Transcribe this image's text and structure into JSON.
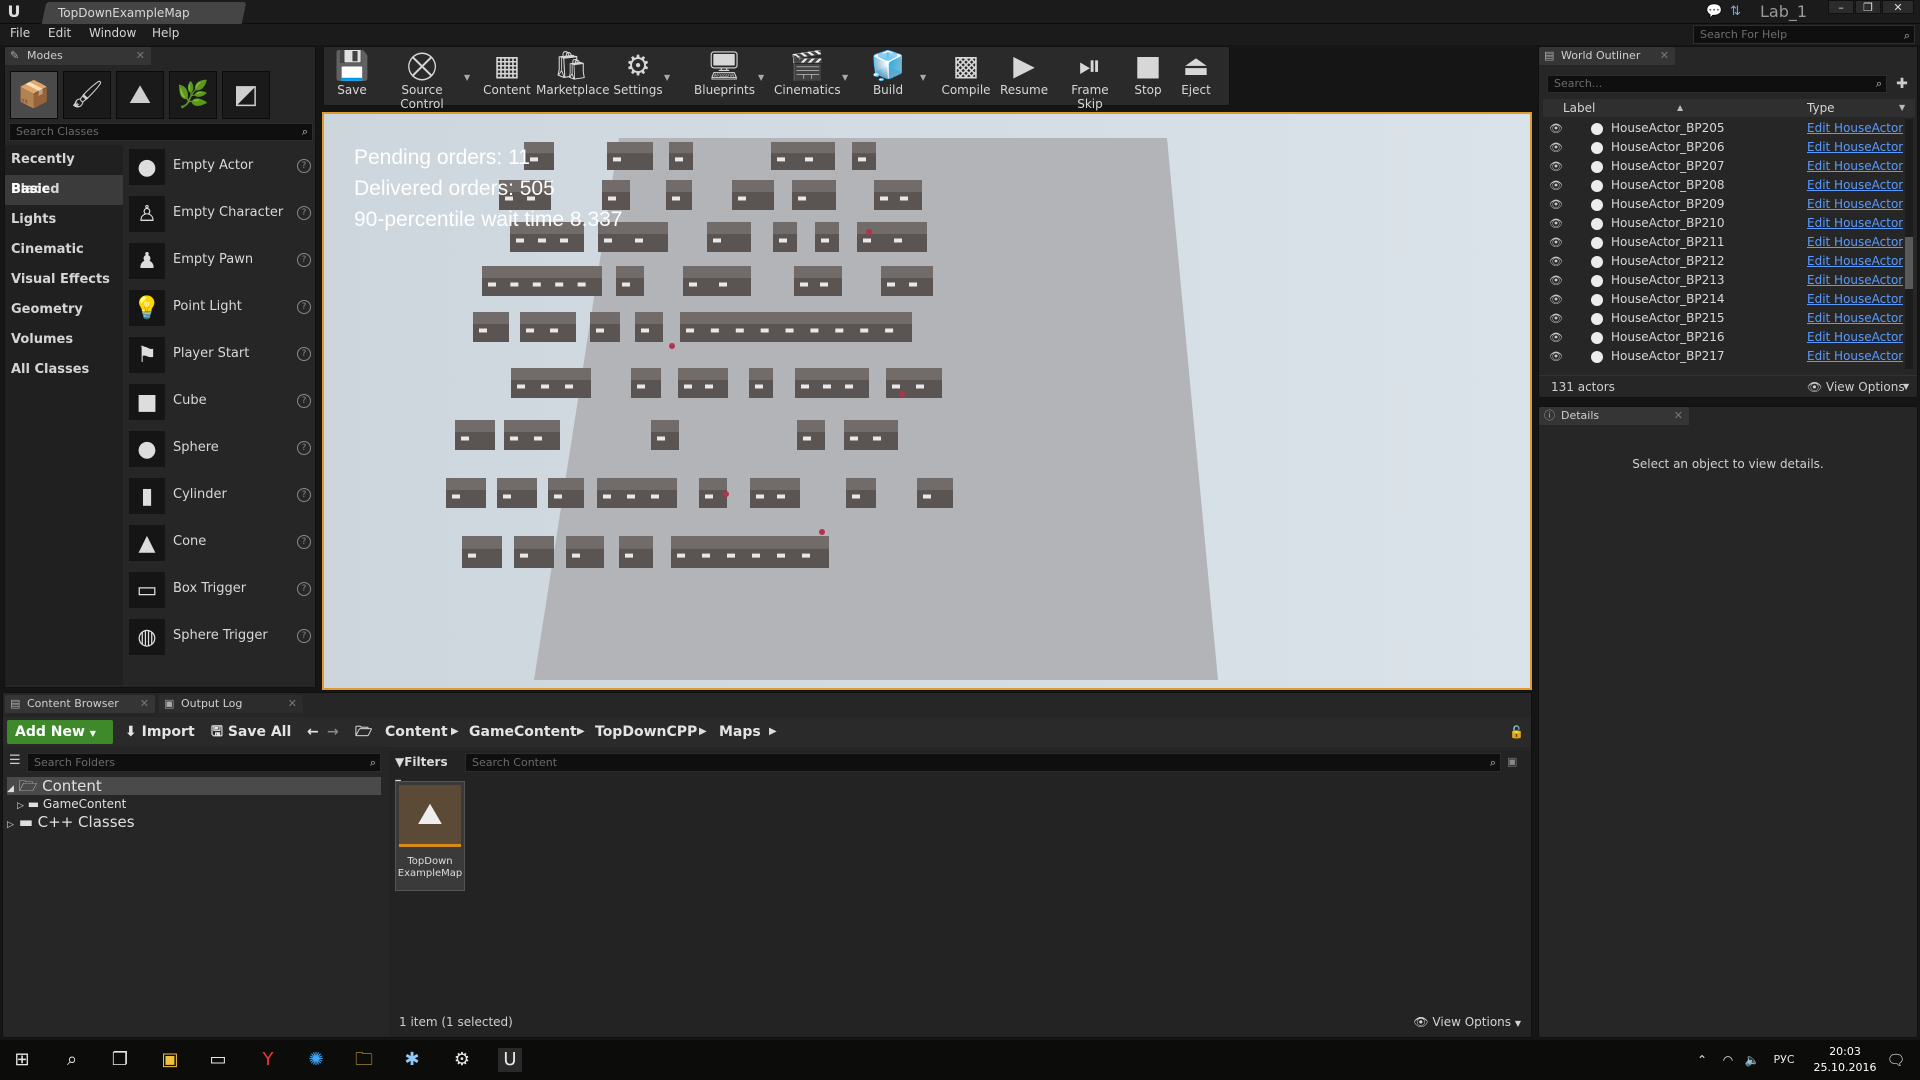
{
  "window": {
    "doc_tab": "TopDownExampleMap",
    "project": "Lab_1",
    "controls": [
      "–",
      "❐",
      "✕"
    ]
  },
  "menu": [
    "File",
    "Edit",
    "Window",
    "Help"
  ],
  "help_search": {
    "placeholder": "Search For Help"
  },
  "modes": {
    "tab": "Modes",
    "search_placeholder": "Search Classes",
    "categories": [
      "Recently Placed",
      "Basic",
      "Lights",
      "Cinematic",
      "Visual Effects",
      "Geometry",
      "Volumes",
      "All Classes"
    ],
    "selected_category": "Basic",
    "items": [
      "Empty Actor",
      "Empty Character",
      "Empty Pawn",
      "Point Light",
      "Player Start",
      "Cube",
      "Sphere",
      "Cylinder",
      "Cone",
      "Box Trigger",
      "Sphere Trigger"
    ]
  },
  "toolbar": {
    "buttons": [
      "Save",
      "Source Control",
      "Content",
      "Marketplace",
      "Settings",
      "Blueprints",
      "Cinematics",
      "Build",
      "Compile",
      "Resume",
      "Frame Skip",
      "Stop",
      "Eject"
    ]
  },
  "viewport": {
    "hud": [
      "Pending orders: 11",
      "Delivered orders: 505",
      "90-percentile wait time 8.337"
    ]
  },
  "outliner": {
    "tab": "World Outliner",
    "search_placeholder": "Search...",
    "col_label": "Label",
    "col_type": "Type",
    "rows": [
      {
        "label": "HouseActor_BP205",
        "type": "Edit HouseActor"
      },
      {
        "label": "HouseActor_BP206",
        "type": "Edit HouseActor"
      },
      {
        "label": "HouseActor_BP207",
        "type": "Edit HouseActor"
      },
      {
        "label": "HouseActor_BP208",
        "type": "Edit HouseActor"
      },
      {
        "label": "HouseActor_BP209",
        "type": "Edit HouseActor"
      },
      {
        "label": "HouseActor_BP210",
        "type": "Edit HouseActor"
      },
      {
        "label": "HouseActor_BP211",
        "type": "Edit HouseActor"
      },
      {
        "label": "HouseActor_BP212",
        "type": "Edit HouseActor"
      },
      {
        "label": "HouseActor_BP213",
        "type": "Edit HouseActor"
      },
      {
        "label": "HouseActor_BP214",
        "type": "Edit HouseActor"
      },
      {
        "label": "HouseActor_BP215",
        "type": "Edit HouseActor"
      },
      {
        "label": "HouseActor_BP216",
        "type": "Edit HouseActor"
      },
      {
        "label": "HouseActor_BP217",
        "type": "Edit HouseActor"
      }
    ],
    "actor_count": "131 actors",
    "view_options": "View Options"
  },
  "details": {
    "tab": "Details",
    "message": "Select an object to view details."
  },
  "bottom_tabs": [
    "Content Browser",
    "Output Log"
  ],
  "content_browser": {
    "add_new": "Add New",
    "import": "Import",
    "save_all": "Save All",
    "breadcrumb": [
      "Content",
      "GameContent",
      "TopDownCPP",
      "Maps"
    ],
    "folder_search_placeholder": "Search Folders",
    "tree": [
      "Content",
      "GameContent",
      "C++ Classes"
    ],
    "filters": "Filters",
    "content_search_placeholder": "Search Content",
    "asset_name": "TopDown ExampleMap",
    "item_count": "1 item (1 selected)",
    "view_options": "View Options"
  },
  "taskbar": {
    "lang": "РУС",
    "time": "20:03",
    "date": "25.10.2016"
  }
}
